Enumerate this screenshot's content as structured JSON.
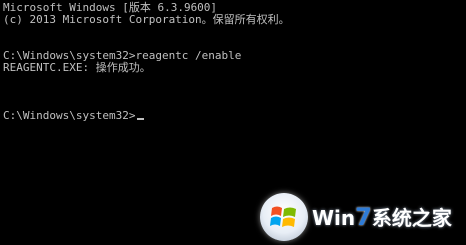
{
  "console": {
    "lines": [
      "Microsoft Windows [版本 6.3.9600]",
      "(c) 2013 Microsoft Corporation。保留所有权利。",
      "C:\\Windows\\system32>reagentc /enable",
      "REAGENTC.EXE: 操作成功。",
      "C:\\Windows\\system32>"
    ],
    "text_color": "#c0c0c0",
    "background_color": "#000000"
  },
  "watermark": {
    "prefix": "Win",
    "seven": "7",
    "suffix": "系统之家",
    "logo_icon": "windows-flag-icon",
    "accent_color": "#2e7bd6"
  }
}
